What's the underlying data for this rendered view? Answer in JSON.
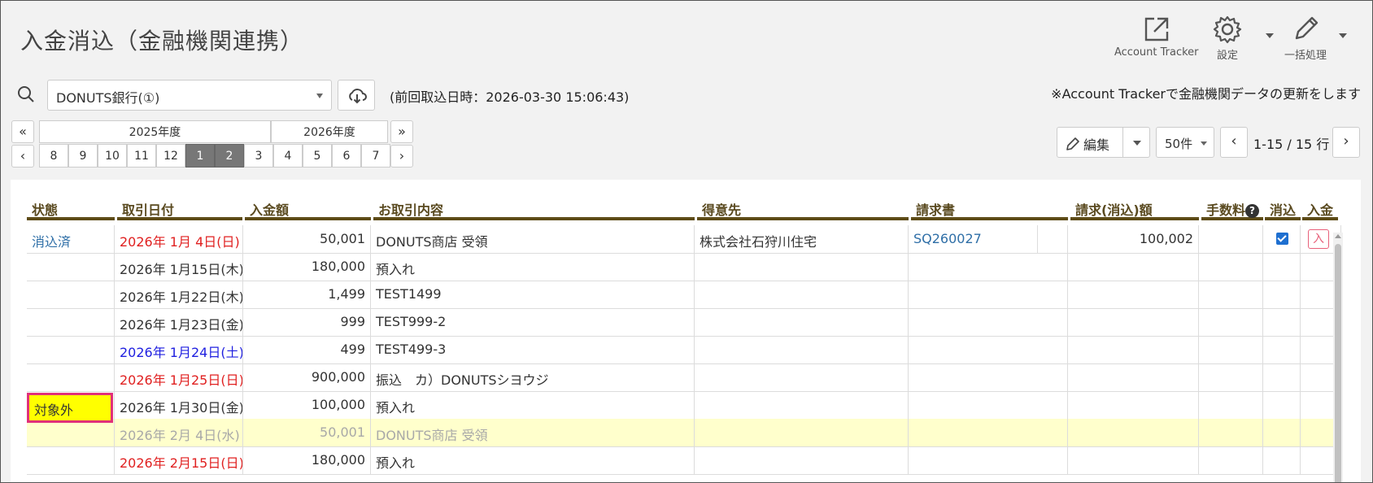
{
  "header": {
    "title": "入金消込（金融機関連携）",
    "tools": {
      "account_tracker": "Account Tracker",
      "settings": "設定",
      "bulk": "一括処理"
    }
  },
  "filter": {
    "bank": "DONUTS銀行(①)",
    "last_import": "(前回取込日時：2026-03-30 15:06:43)",
    "notice": "※Account Trackerで金融機関データの更新をします"
  },
  "periods": {
    "first": "«",
    "prev": "‹",
    "next_year": "»",
    "next": "›",
    "years": [
      "2025年度",
      "2026年度"
    ],
    "months": [
      "8",
      "9",
      "10",
      "11",
      "12",
      "1",
      "2",
      "3",
      "4",
      "5",
      "6",
      "7"
    ],
    "selected": [
      "1",
      "2"
    ]
  },
  "toolbar": {
    "edit": "編集",
    "per_page": "50件",
    "prev": "‹",
    "next": "›",
    "range": "1-15 / 15 行"
  },
  "table": {
    "columns": {
      "status": "状態",
      "date": "取引日付",
      "amount": "入金額",
      "desc": "お取引内容",
      "customer": "得意先",
      "invoice": "請求書",
      "billed": "請求(消込)額",
      "fee": "手数料",
      "fee_help": "?",
      "clear": "消込",
      "deposit": "入金"
    },
    "rows": [
      {
        "status": "消込済",
        "date": "2026年 1月 4日(日)",
        "amount": "50,001",
        "desc": "DONUTS商店 受領",
        "customer": "株式会社石狩川住宅",
        "invoice": "SQ260027",
        "billed": "100,002",
        "checked": true,
        "badge": "入"
      },
      {
        "status": "",
        "date": "2026年 1月15日(木)",
        "amount": "180,000",
        "desc": "預入れ"
      },
      {
        "status": "",
        "date": "2026年 1月22日(木)",
        "amount": "1,499",
        "desc": "TEST1499"
      },
      {
        "status": "",
        "date": "2026年 1月23日(金)",
        "amount": "999",
        "desc": "TEST999-2"
      },
      {
        "status": "",
        "date": "2026年 1月24日(土)",
        "amount": "499",
        "desc": "TEST499-3"
      },
      {
        "status": "",
        "date": "2026年 1月25日(日)",
        "amount": "900,000",
        "desc": "振込　カ）DONUTSシヨウジ"
      },
      {
        "status": "",
        "date": "2026年 1月30日(金)",
        "amount": "100,000",
        "desc": "預入れ"
      },
      {
        "status": "対象外",
        "date": "2026年 2月 4日(水)",
        "amount": "50,001",
        "desc": "DONUTS商店 受領"
      },
      {
        "status": "",
        "date": "2026年 2月15日(日)",
        "amount": "180,000",
        "desc": "預入れ"
      }
    ]
  }
}
